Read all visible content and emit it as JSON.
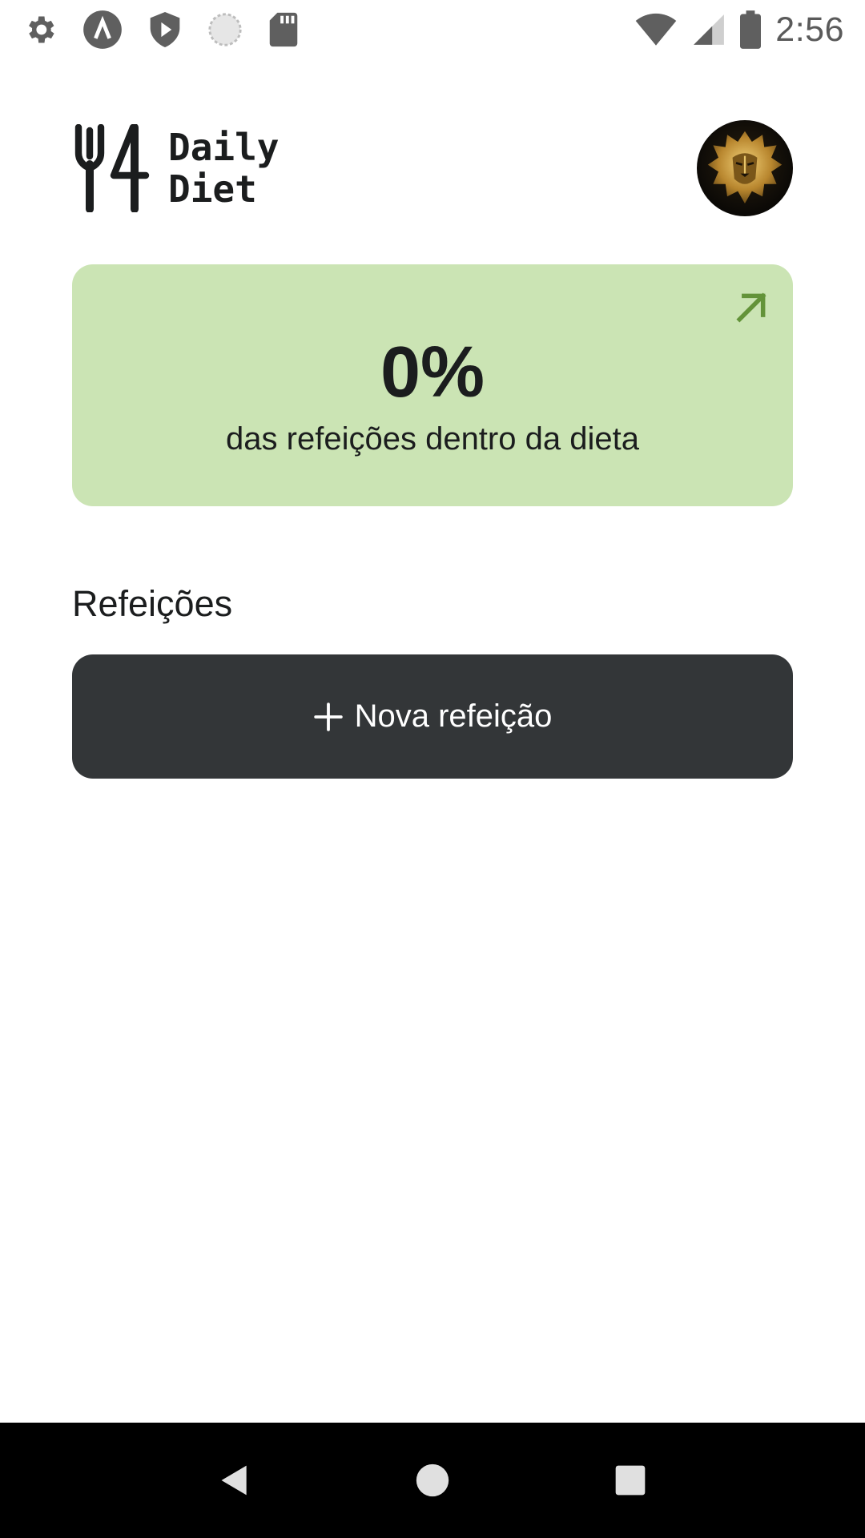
{
  "status_bar": {
    "time": "2:56",
    "icons_left": [
      "settings-icon",
      "app-a-icon",
      "shield-play-icon",
      "loading-circle-icon",
      "sd-card-icon"
    ],
    "icons_right": [
      "wifi-icon",
      "cell-signal-icon",
      "battery-icon"
    ]
  },
  "header": {
    "logo_line1": "Daily",
    "logo_line2": "Diet",
    "avatar_icon": "lion-avatar"
  },
  "stats": {
    "percent": "0%",
    "label": "das refeições dentro da dieta",
    "color": "#cbe4b4",
    "arrow_color": "#639339"
  },
  "meals": {
    "section_title": "Refeições",
    "new_button_label": "Nova refeição",
    "button_color": "#333638"
  },
  "nav_bar": {
    "buttons": [
      "back-icon",
      "home-icon",
      "recents-icon"
    ]
  }
}
